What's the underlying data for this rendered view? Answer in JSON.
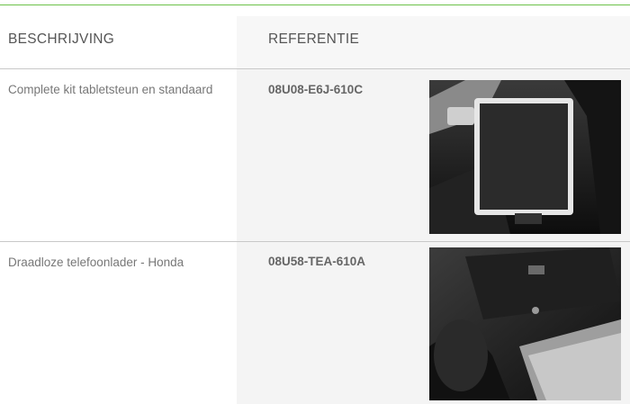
{
  "table": {
    "headers": {
      "description": "BESCHRIJVING",
      "reference": "REFERENTIE"
    },
    "rows": [
      {
        "description": "Complete kit tabletsteun en standaard",
        "reference": "08U08-E6J-610C",
        "image_icon": "tablet-holder-photo"
      },
      {
        "description": "Draadloze telefoonlader - Honda",
        "reference": "08U58-TEA-610A",
        "image_icon": "wireless-charger-photo"
      }
    ]
  },
  "colors": {
    "accent_rule": "#6cc24a",
    "reference_column_bg": "#f4f4f4",
    "text_muted": "#777777"
  }
}
